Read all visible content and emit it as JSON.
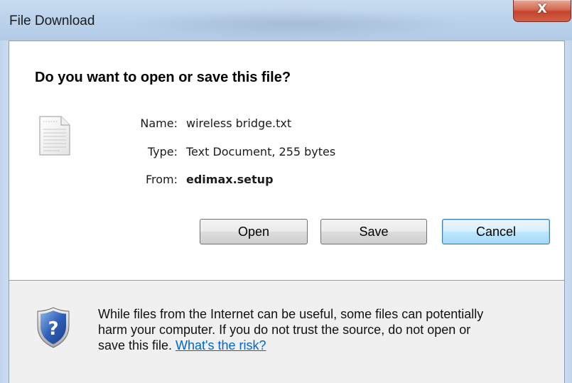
{
  "window": {
    "title": "File Download",
    "close_glyph": "X"
  },
  "prompt": {
    "heading": "Do you want to open or save this file?"
  },
  "file": {
    "icon": "text-document-icon",
    "name_label": "Name:",
    "name_value": "wireless  bridge.txt",
    "type_label": "Type:",
    "type_value": "Text Document, 255 bytes",
    "from_label": "From:",
    "from_value": "edimax.setup"
  },
  "buttons": {
    "open": "Open",
    "save": "Save",
    "cancel": "Cancel"
  },
  "warning": {
    "icon": "shield-question-icon",
    "line1": "While files from the Internet can be useful, some files can potentially",
    "line2": "harm your computer. If you do not trust the source, do not open or",
    "line3_prefix": "save this file. ",
    "risk_link": "What's the risk?"
  },
  "colors": {
    "link": "#0066cc",
    "default_button_border": "#3c7fb1",
    "close_button": "#c4442b"
  }
}
